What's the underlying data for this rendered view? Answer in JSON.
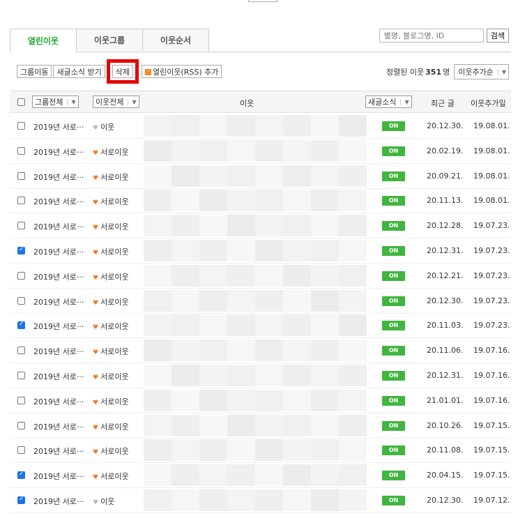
{
  "tabs": [
    {
      "label": "열린이웃",
      "active": true
    },
    {
      "label": "이웃그룹",
      "active": false
    },
    {
      "label": "이웃순서",
      "active": false
    }
  ],
  "search": {
    "placeholder": "별명, 블로그명, ID",
    "button": "검색"
  },
  "toolbar": {
    "group_move": "그룹이동",
    "receive_news": "새글소식 받기",
    "delete": "삭제",
    "rss_add": "열린이웃(RSS) 추가"
  },
  "sort": {
    "label": "정렬된 이웃",
    "count": "351",
    "unit": "명",
    "selected": "이웃추가순"
  },
  "header": {
    "group_all": "그룹전체",
    "neighbor_all": "이웃전체",
    "neighbor": "이웃",
    "new_post": "새글소식",
    "recent": "최근 글",
    "added": "이웃추가일"
  },
  "on_label": "ON",
  "rows": [
    {
      "checked": false,
      "group": "2019년 서로···",
      "type": "이웃",
      "heart": "gray",
      "recent": "20.12.30.",
      "added": "19.08.01."
    },
    {
      "checked": false,
      "group": "2019년 서로···",
      "type": "서로이웃",
      "heart": "orange",
      "recent": "20.02.19.",
      "added": "19.08.01."
    },
    {
      "checked": false,
      "group": "2019년 서로···",
      "type": "서로이웃",
      "heart": "orange",
      "recent": "20.09.21.",
      "added": "19.08.01."
    },
    {
      "checked": false,
      "group": "2019년 서로···",
      "type": "서로이웃",
      "heart": "orange",
      "recent": "20.11.13.",
      "added": "19.08.01."
    },
    {
      "checked": false,
      "group": "2019년 서로···",
      "type": "서로이웃",
      "heart": "orange",
      "recent": "20.12.28.",
      "added": "19.07.23."
    },
    {
      "checked": true,
      "group": "2019년 서로···",
      "type": "서로이웃",
      "heart": "orange",
      "recent": "20.12.31.",
      "added": "19.07.23."
    },
    {
      "checked": false,
      "group": "2019년 서로···",
      "type": "서로이웃",
      "heart": "orange",
      "recent": "20.12.21.",
      "added": "19.07.23."
    },
    {
      "checked": false,
      "group": "2019년 서로···",
      "type": "서로이웃",
      "heart": "orange",
      "recent": "20.12.30.",
      "added": "19.07.23."
    },
    {
      "checked": true,
      "group": "2019년 서로···",
      "type": "서로이웃",
      "heart": "orange",
      "recent": "20.11.03.",
      "added": "19.07.23."
    },
    {
      "checked": false,
      "group": "2019년 서로···",
      "type": "서로이웃",
      "heart": "orange",
      "recent": "20.11.06.",
      "added": "19.07.16."
    },
    {
      "checked": false,
      "group": "2019년 서로···",
      "type": "서로이웃",
      "heart": "orange",
      "recent": "20.12.31.",
      "added": "19.07.16."
    },
    {
      "checked": false,
      "group": "2019년 서로···",
      "type": "서로이웃",
      "heart": "orange",
      "recent": "21.01.01.",
      "added": "19.07.16."
    },
    {
      "checked": false,
      "group": "2019년 서로···",
      "type": "서로이웃",
      "heart": "orange",
      "recent": "20.10.26.",
      "added": "19.07.15."
    },
    {
      "checked": false,
      "group": "2019년 서로···",
      "type": "서로이웃",
      "heart": "orange",
      "recent": "20.11.08.",
      "added": "19.07.15."
    },
    {
      "checked": true,
      "group": "2019년 서로···",
      "type": "서로이웃",
      "heart": "orange",
      "recent": "20.04.15.",
      "added": "19.07.15."
    },
    {
      "checked": true,
      "group": "2019년 서로···",
      "type": "이웃",
      "heart": "gray",
      "recent": "20.12.30.",
      "added": "19.07.12."
    }
  ],
  "colors": {
    "accent": "#1fa72a",
    "on": "#41b53f",
    "highlight": "#e60000",
    "checkbox": "#1a73e8"
  }
}
